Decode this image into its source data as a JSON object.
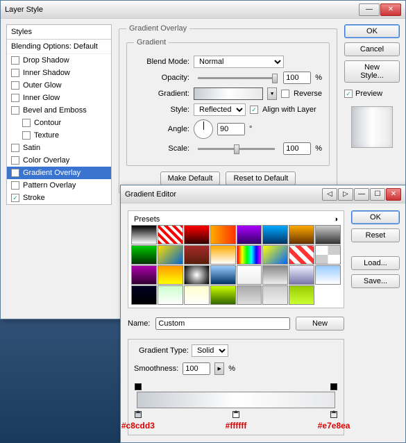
{
  "layerStyle": {
    "title": "Layer Style",
    "stylesHeader": "Styles",
    "blendingHeader": "Blending Options: Default",
    "items": [
      {
        "label": "Drop Shadow",
        "checked": false,
        "sub": false
      },
      {
        "label": "Inner Shadow",
        "checked": false,
        "sub": false
      },
      {
        "label": "Outer Glow",
        "checked": false,
        "sub": false
      },
      {
        "label": "Inner Glow",
        "checked": false,
        "sub": false
      },
      {
        "label": "Bevel and Emboss",
        "checked": false,
        "sub": false
      },
      {
        "label": "Contour",
        "checked": false,
        "sub": true
      },
      {
        "label": "Texture",
        "checked": false,
        "sub": true
      },
      {
        "label": "Satin",
        "checked": false,
        "sub": false
      },
      {
        "label": "Color Overlay",
        "checked": false,
        "sub": false
      },
      {
        "label": "Gradient Overlay",
        "checked": true,
        "sub": false,
        "selected": true
      },
      {
        "label": "Pattern Overlay",
        "checked": false,
        "sub": false
      },
      {
        "label": "Stroke",
        "checked": true,
        "sub": false
      }
    ],
    "section": {
      "title": "Gradient Overlay",
      "gradientGroup": "Gradient",
      "blendModeLabel": "Blend Mode:",
      "blendMode": "Normal",
      "opacityLabel": "Opacity:",
      "opacity": "100",
      "pct": "%",
      "gradientLabel": "Gradient:",
      "reverseLabel": "Reverse",
      "styleLabel": "Style:",
      "style": "Reflected",
      "alignLabel": "Align with Layer",
      "angleLabel": "Angle:",
      "angle": "90",
      "deg": "°",
      "scaleLabel": "Scale:",
      "scale": "100",
      "makeDefault": "Make Default",
      "resetDefault": "Reset to Default"
    },
    "buttons": {
      "ok": "OK",
      "cancel": "Cancel",
      "newStyle": "New Style...",
      "previewLabel": "Preview"
    }
  },
  "gradientEditor": {
    "title": "Gradient Editor",
    "presetsLabel": "Presets",
    "nameLabel": "Name:",
    "nameValue": "Custom",
    "newBtn": "New",
    "gradTypeLabel": "Gradient Type:",
    "gradType": "Solid",
    "smoothLabel": "Smoothness:",
    "smooth": "100",
    "pct": "%",
    "buttons": {
      "ok": "OK",
      "reset": "Reset",
      "load": "Load...",
      "save": "Save..."
    },
    "stops": [
      {
        "pos": 0,
        "hex": "#c8cdd3"
      },
      {
        "pos": 50,
        "hex": "#ffffff"
      },
      {
        "pos": 100,
        "hex": "#e7e8ea"
      }
    ],
    "swatches": [
      "linear-gradient(180deg,#000,#fff)",
      "repeating-linear-gradient(45deg,#f00 0 4px,#fff 4px 8px)",
      "linear-gradient(180deg,#f00,#300)",
      "linear-gradient(90deg,#fa0,#f30)",
      "linear-gradient(180deg,#a0f,#306)",
      "linear-gradient(180deg,#0af,#036)",
      "linear-gradient(180deg,#fa0,#630)",
      "linear-gradient(180deg,#ccc,#333)",
      "linear-gradient(180deg,#0c0,#030)",
      "linear-gradient(135deg,#fd0,#06c)",
      "linear-gradient(180deg,#a52a2a,#5a1e0a)",
      "linear-gradient(180deg,#fa0,#fff)",
      "linear-gradient(90deg,red,yellow,lime,cyan,blue,magenta)",
      "linear-gradient(135deg,#ff0,#06f)",
      "repeating-linear-gradient(45deg,#f33 0 6px,#fff 6px 12px)",
      "repeating-conic-gradient(#ccc 0 25%,#fff 0 50%)",
      "linear-gradient(180deg,#a0a,#303)",
      "linear-gradient(180deg,#f90,#ff0)",
      "radial-gradient(circle,#fff,#000)",
      "linear-gradient(180deg,#9cf,#036)",
      "linear-gradient(180deg,#fff,#eee)",
      "linear-gradient(180deg,#888,#eee)",
      "linear-gradient(180deg,#eef,#77a)",
      "linear-gradient(180deg,#9cf,#fff)",
      "linear-gradient(180deg,#002,#000)",
      "linear-gradient(180deg,#cfc,#fff)",
      "linear-gradient(180deg,#ffc,#fff)",
      "linear-gradient(180deg,#cf0,#360)",
      "linear-gradient(180deg,#aaa,#ddd)",
      "linear-gradient(180deg,#ccc,#eee)",
      "linear-gradient(180deg,#9c0,#cf3)"
    ]
  }
}
